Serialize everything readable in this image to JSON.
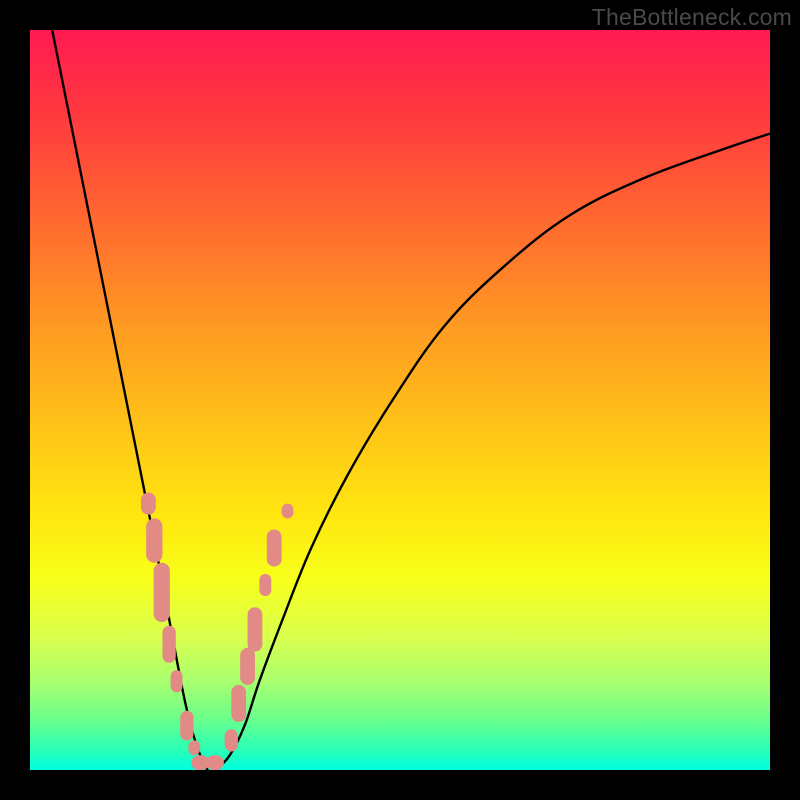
{
  "watermark": "TheBottleneck.com",
  "chart_data": {
    "type": "line",
    "title": "",
    "xlabel": "",
    "ylabel": "",
    "xlim": [
      0,
      100
    ],
    "ylim": [
      0,
      100
    ],
    "grid": false,
    "legend": false,
    "series": [
      {
        "name": "curve",
        "color": "#000000",
        "x": [
          3,
          5,
          7,
          9,
          11,
          13,
          15,
          17,
          18.5,
          20,
          21,
          22,
          23,
          24,
          25,
          27,
          29,
          31,
          34,
          38,
          43,
          49,
          56,
          64,
          73,
          83,
          94,
          100
        ],
        "y": [
          100,
          90,
          80,
          70,
          60,
          50,
          40,
          30,
          22,
          14,
          9,
          5,
          2,
          0,
          0,
          2,
          6,
          12,
          20,
          30,
          40,
          50,
          60,
          68,
          75,
          80,
          84,
          86
        ]
      }
    ],
    "markers": {
      "name": "notch-beads",
      "color": "#e28a85",
      "shape": "rounded-rect",
      "points": [
        {
          "x": 16.0,
          "y": 36,
          "w": 2.0,
          "h": 3
        },
        {
          "x": 16.8,
          "y": 31,
          "w": 2.2,
          "h": 6
        },
        {
          "x": 17.8,
          "y": 24,
          "w": 2.2,
          "h": 8
        },
        {
          "x": 18.8,
          "y": 17,
          "w": 1.8,
          "h": 5
        },
        {
          "x": 19.8,
          "y": 12,
          "w": 1.6,
          "h": 3
        },
        {
          "x": 21.2,
          "y": 6,
          "w": 1.8,
          "h": 4
        },
        {
          "x": 22.2,
          "y": 3,
          "w": 1.6,
          "h": 2
        },
        {
          "x": 23.0,
          "y": 1,
          "w": 2.4,
          "h": 2
        },
        {
          "x": 25.0,
          "y": 1,
          "w": 2.4,
          "h": 2
        },
        {
          "x": 27.2,
          "y": 4,
          "w": 1.8,
          "h": 3
        },
        {
          "x": 28.2,
          "y": 9,
          "w": 2.0,
          "h": 5
        },
        {
          "x": 29.4,
          "y": 14,
          "w": 2.0,
          "h": 5
        },
        {
          "x": 30.4,
          "y": 19,
          "w": 2.0,
          "h": 6
        },
        {
          "x": 31.8,
          "y": 25,
          "w": 1.6,
          "h": 3
        },
        {
          "x": 33.0,
          "y": 30,
          "w": 2.0,
          "h": 5
        },
        {
          "x": 34.8,
          "y": 35,
          "w": 1.6,
          "h": 2
        }
      ]
    }
  }
}
